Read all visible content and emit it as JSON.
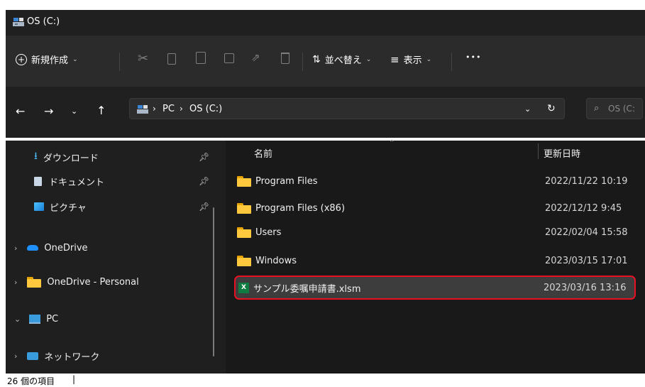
{
  "window": {
    "title": "OS (C:)"
  },
  "toolbar": {
    "new_label": "新規作成",
    "sort_label": "並べ替え",
    "view_label": "表示",
    "more_label": "•••"
  },
  "address": {
    "crumbs": [
      "PC",
      "OS (C:)"
    ],
    "search_placeholder": "OS (C:"
  },
  "nav": {
    "quick": [
      {
        "label": "ダウンロード",
        "icon": "download-icon",
        "pinned": true
      },
      {
        "label": "ドキュメント",
        "icon": "document-icon",
        "pinned": true
      },
      {
        "label": "ピクチャ",
        "icon": "pictures-icon",
        "pinned": true
      }
    ],
    "onedrive": "OneDrive",
    "onedrive_personal": "OneDrive - Personal",
    "pc": "PC",
    "network": "ネットワーク"
  },
  "content": {
    "headers": {
      "name": "名前",
      "date": "更新日時"
    },
    "items": [
      {
        "name": "Program Files",
        "date": "2022/11/22 10:19",
        "type": "folder"
      },
      {
        "name": "Program Files (x86)",
        "date": "2022/12/12 9:45",
        "type": "folder"
      },
      {
        "name": "Users",
        "date": "2022/02/04 15:58",
        "type": "folder"
      },
      {
        "name": "Windows",
        "date": "2023/03/15 17:01",
        "type": "folder"
      },
      {
        "name": "サンプル委嘱申請書.xlsm",
        "date": "2023/03/16 13:16",
        "type": "excel",
        "selected": true
      }
    ]
  },
  "status": {
    "count": "26 個の項目",
    "sep": "|"
  },
  "colors": {
    "accent": "#0a84ff",
    "selection_highlight": "#e81123",
    "folder": "#ffc83d",
    "excel": "#107c41"
  }
}
